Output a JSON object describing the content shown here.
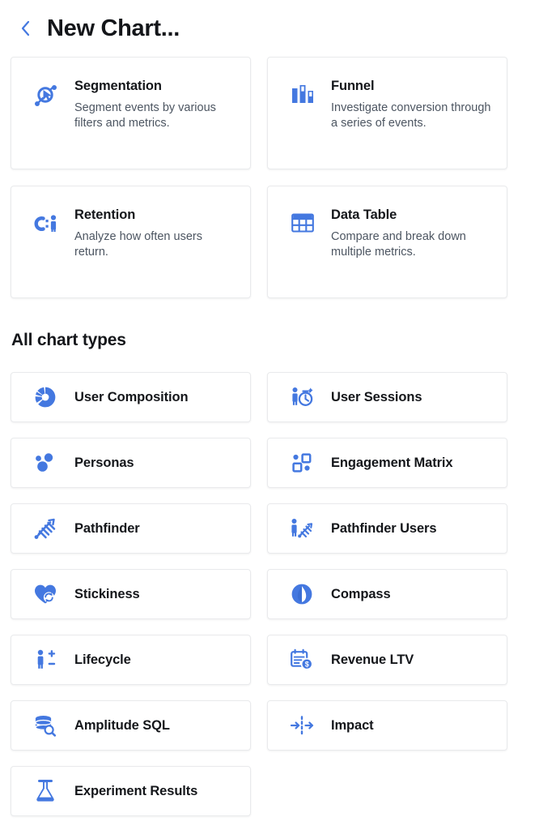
{
  "header": {
    "back_icon": "chevron-left-icon",
    "title": "New Chart..."
  },
  "theme": {
    "accent": "#4478E0",
    "title_color": "#14161a",
    "desc_color": "#4c5561",
    "card_border": "#e9eaec",
    "background": "#ffffff"
  },
  "featured": {
    "cards": [
      {
        "icon": "segmentation-icon",
        "title": "Segmentation",
        "description": "Segment events by various filters and metrics."
      },
      {
        "icon": "funnel-icon",
        "title": "Funnel",
        "description": "Investigate conversion through a series of events."
      },
      {
        "icon": "retention-icon",
        "title": "Retention",
        "description": "Analyze how often users return."
      },
      {
        "icon": "data-table-icon",
        "title": "Data Table",
        "description": "Compare and break down multiple metrics."
      }
    ]
  },
  "all_chart_types": {
    "heading": "All chart types",
    "items": [
      {
        "icon": "user-composition-icon",
        "label": "User Composition"
      },
      {
        "icon": "user-sessions-icon",
        "label": "User Sessions"
      },
      {
        "icon": "personas-icon",
        "label": "Personas"
      },
      {
        "icon": "engagement-matrix-icon",
        "label": "Engagement Matrix"
      },
      {
        "icon": "pathfinder-icon",
        "label": "Pathfinder"
      },
      {
        "icon": "pathfinder-users-icon",
        "label": "Pathfinder Users"
      },
      {
        "icon": "stickiness-icon",
        "label": "Stickiness"
      },
      {
        "icon": "compass-icon",
        "label": "Compass"
      },
      {
        "icon": "lifecycle-icon",
        "label": "Lifecycle"
      },
      {
        "icon": "revenue-ltv-icon",
        "label": "Revenue LTV"
      },
      {
        "icon": "amplitude-sql-icon",
        "label": "Amplitude SQL"
      },
      {
        "icon": "impact-icon",
        "label": "Impact"
      },
      {
        "icon": "experiment-results-icon",
        "label": "Experiment Results"
      }
    ]
  }
}
